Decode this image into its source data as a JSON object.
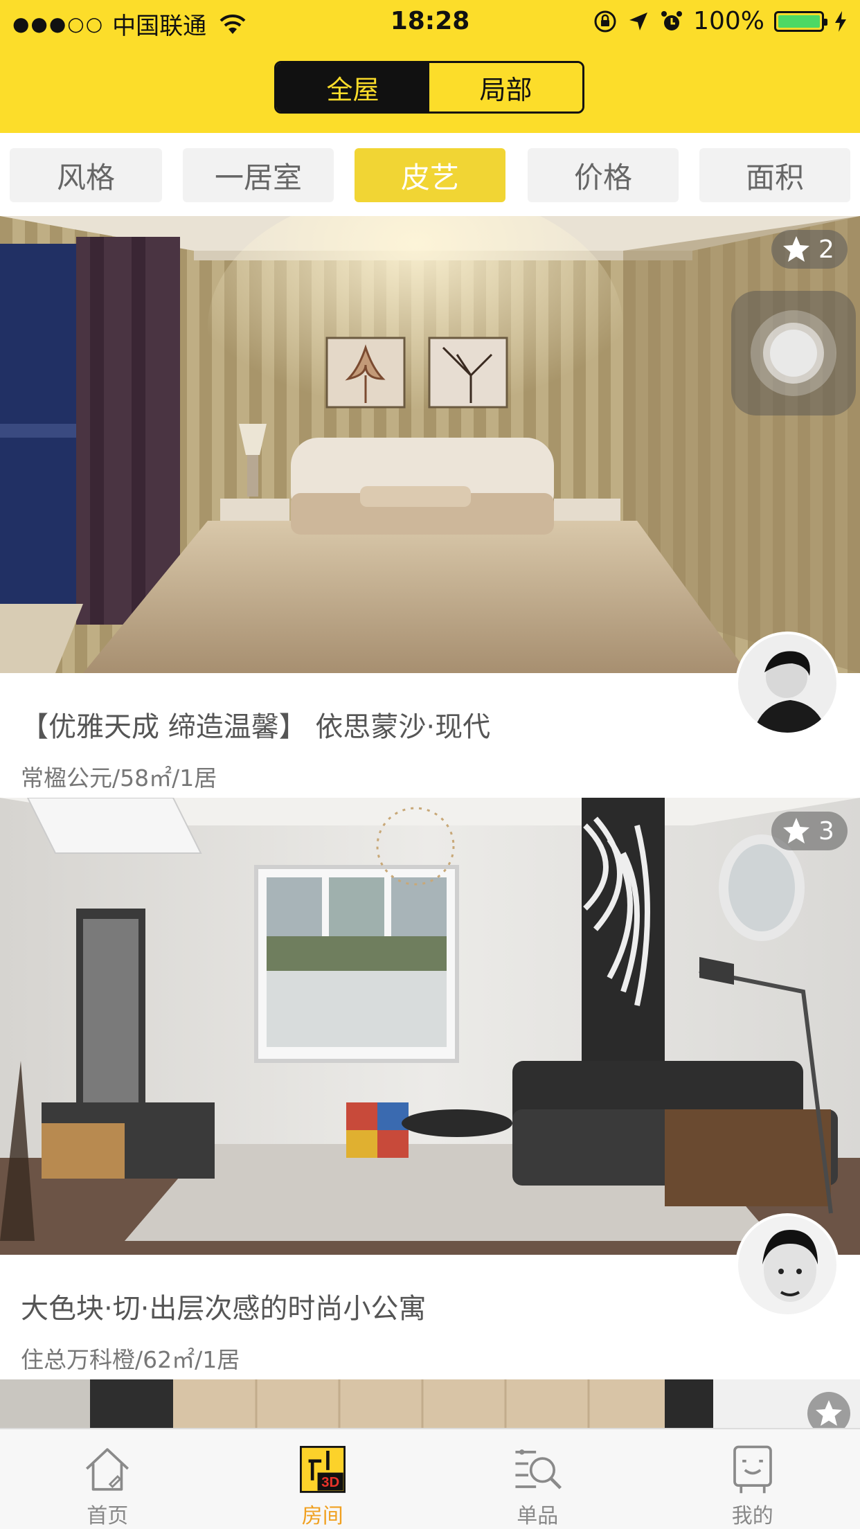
{
  "status_bar": {
    "signal_dots": "●●●○○",
    "carrier": "中国联通",
    "time": "18:28",
    "battery_pct": "100%",
    "battery_level": 1.0,
    "icons": [
      "wifi-icon",
      "orientation-lock-icon",
      "location-icon",
      "alarm-icon",
      "charging-icon"
    ]
  },
  "header": {
    "segment": [
      {
        "label": "全屋",
        "active": true
      },
      {
        "label": "局部",
        "active": false
      }
    ]
  },
  "filters": [
    {
      "label": "风格",
      "active": false
    },
    {
      "label": "一居室",
      "active": false
    },
    {
      "label": "皮艺",
      "active": true
    },
    {
      "label": "价格",
      "active": false
    },
    {
      "label": "面积",
      "active": false
    }
  ],
  "cards": [
    {
      "title": "【优雅天成 缔造温馨】 依思蒙沙·现代",
      "subtitle": "常楹公元/58㎡/1居",
      "stars": "2",
      "image": "bedroom-photo"
    },
    {
      "title": "大色块·切·出层次感的时尚小公寓",
      "subtitle": "住总万科橙/62㎡/1居",
      "stars": "3",
      "image": "living-room-photo"
    }
  ],
  "tabbar": [
    {
      "label": "首页",
      "icon": "home-icon",
      "active": false
    },
    {
      "label": "房间",
      "icon": "room-3d-icon",
      "active": true
    },
    {
      "label": "单品",
      "icon": "product-search-icon",
      "active": false
    },
    {
      "label": "我的",
      "icon": "profile-icon",
      "active": false
    }
  ],
  "colors": {
    "brand_yellow": "#fcdd2a",
    "active_filter": "#f1d534",
    "active_tab": "#f0a020"
  }
}
